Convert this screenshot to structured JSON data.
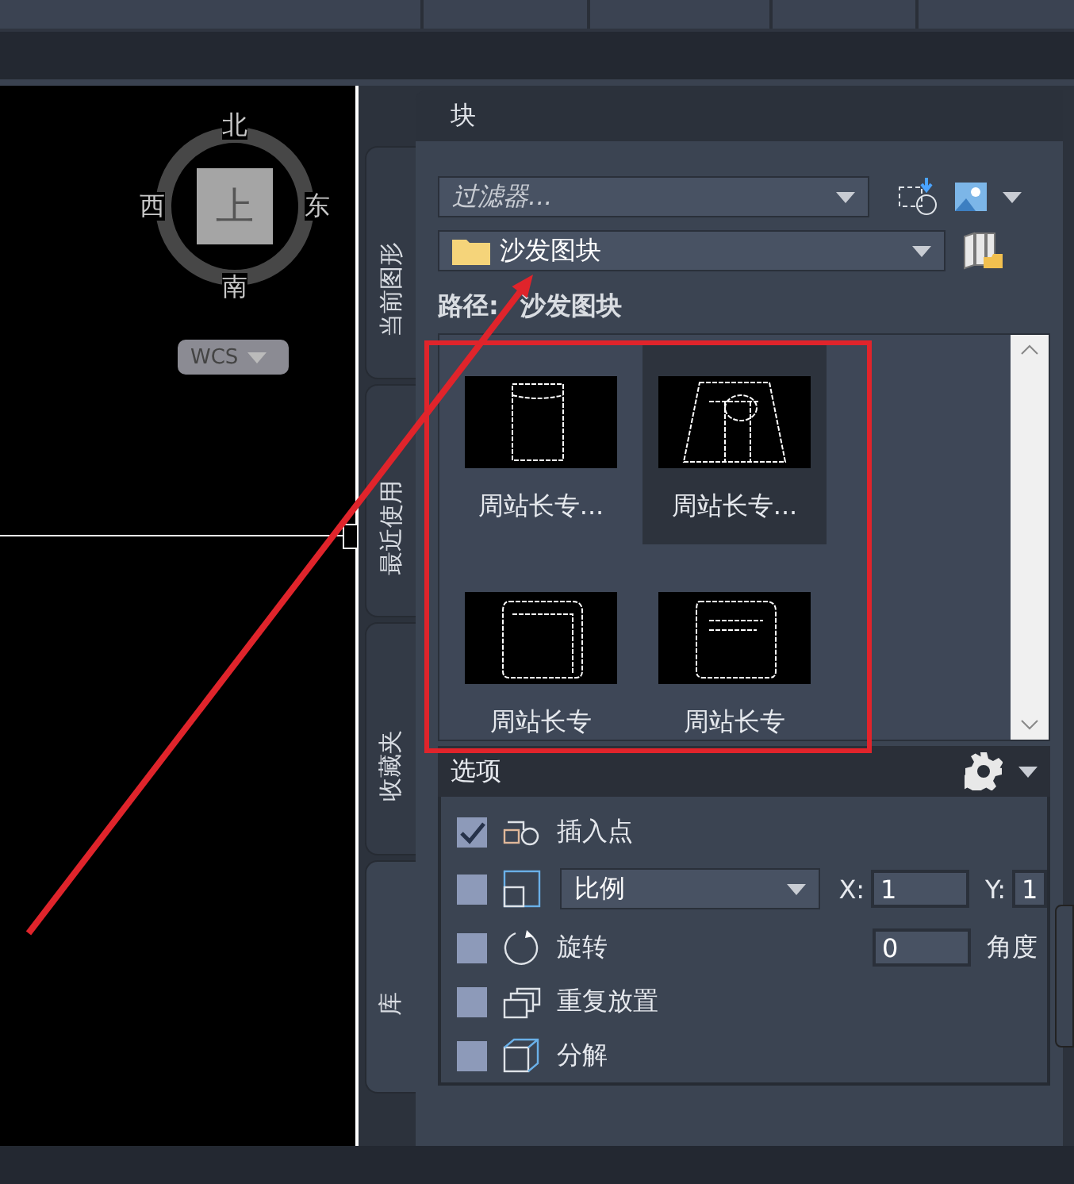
{
  "viewport": {
    "compass": {
      "north": "北",
      "south": "南",
      "east": "东",
      "west": "西",
      "center": "上"
    },
    "ucs_button": "WCS"
  },
  "palette": {
    "side_tabs": [
      {
        "label": "当前图形",
        "selected": false
      },
      {
        "label": "最近使用",
        "selected": false
      },
      {
        "label": "收藏夹",
        "selected": false
      },
      {
        "label": "库",
        "selected": true
      }
    ],
    "title": "块",
    "filter": {
      "placeholder": "过滤器..."
    },
    "folder": {
      "value": "沙发图块"
    },
    "path_label": "**路径: 沙发图块**",
    "blocks": [
      {
        "label": "周站长专...",
        "selected": false,
        "kind": "chair"
      },
      {
        "label": "周站长专...",
        "selected": true,
        "kind": "sofa"
      },
      {
        "label": "周站长专",
        "selected": false,
        "kind": "armchair"
      },
      {
        "label": "周站长专",
        "selected": false,
        "kind": "loveseat"
      }
    ],
    "options": {
      "title": "选项",
      "rows": [
        {
          "kind": "plain",
          "label": "插入点",
          "checked": true
        },
        {
          "kind": "scale",
          "select": "比例",
          "x_label": "X:",
          "x_value": "1",
          "y_label": "Y:",
          "y_value": "1",
          "checked": false
        },
        {
          "kind": "rotate",
          "label": "旋转",
          "value": "0",
          "unit": "角度",
          "checked": false
        },
        {
          "kind": "plain",
          "label": "重复放置",
          "checked": false
        },
        {
          "kind": "plain",
          "label": "分解",
          "checked": false
        }
      ]
    }
  }
}
